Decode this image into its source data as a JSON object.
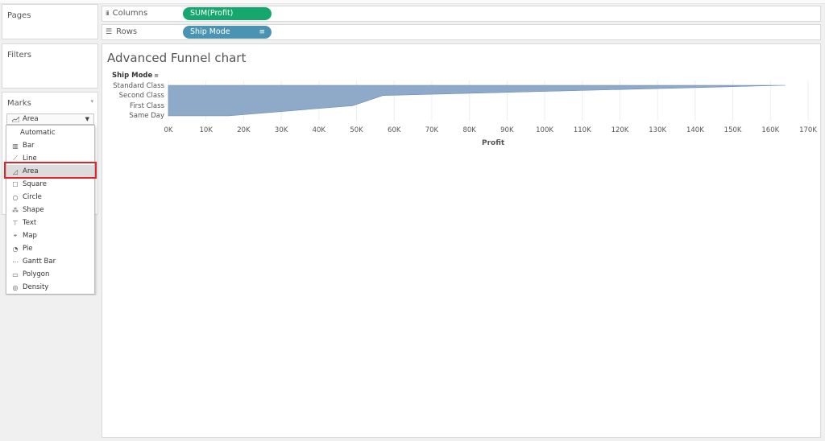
{
  "pages": {
    "title": "Pages"
  },
  "filters": {
    "title": "Filters"
  },
  "marks": {
    "title": "Marks",
    "selected_value": "Area",
    "options": [
      {
        "label": "Automatic",
        "icon": "none"
      },
      {
        "label": "Bar",
        "icon": "bar-chart-icon"
      },
      {
        "label": "Line",
        "icon": "line-chart-icon"
      },
      {
        "label": "Area",
        "icon": "area-chart-icon"
      },
      {
        "label": "Square",
        "icon": "square-icon"
      },
      {
        "label": "Circle",
        "icon": "circle-icon"
      },
      {
        "label": "Shape",
        "icon": "shape-icon"
      },
      {
        "label": "Text",
        "icon": "text-icon"
      },
      {
        "label": "Map",
        "icon": "map-icon"
      },
      {
        "label": "Pie",
        "icon": "pie-icon"
      },
      {
        "label": "Gantt Bar",
        "icon": "gantt-icon"
      },
      {
        "label": "Polygon",
        "icon": "polygon-icon"
      },
      {
        "label": "Density",
        "icon": "density-icon"
      }
    ]
  },
  "shelves": {
    "columns": {
      "label": "Columns",
      "pill": "SUM(Profit)"
    },
    "rows": {
      "label": "Rows",
      "pill": "Ship Mode"
    }
  },
  "colors": {
    "pill_green": "#14a86e",
    "pill_blue": "#4b93b3",
    "area_fill": "#8fa9c8",
    "area_stroke": "#6a8bb3",
    "highlight": "#e3202b"
  },
  "chart_data": {
    "type": "area",
    "title": "Advanced Funnel chart",
    "row_header": "Ship Mode",
    "categories": [
      "Standard Class",
      "Second Class",
      "First Class",
      "Same Day"
    ],
    "values": [
      164000,
      57000,
      49000,
      16000
    ],
    "xlabel": "Profit",
    "xlim": [
      0,
      170000
    ],
    "x_ticks": [
      "0K",
      "10K",
      "20K",
      "30K",
      "40K",
      "50K",
      "60K",
      "70K",
      "80K",
      "90K",
      "100K",
      "110K",
      "120K",
      "130K",
      "140K",
      "150K",
      "160K",
      "170K"
    ],
    "grid": true,
    "orientation": "horizontal"
  }
}
